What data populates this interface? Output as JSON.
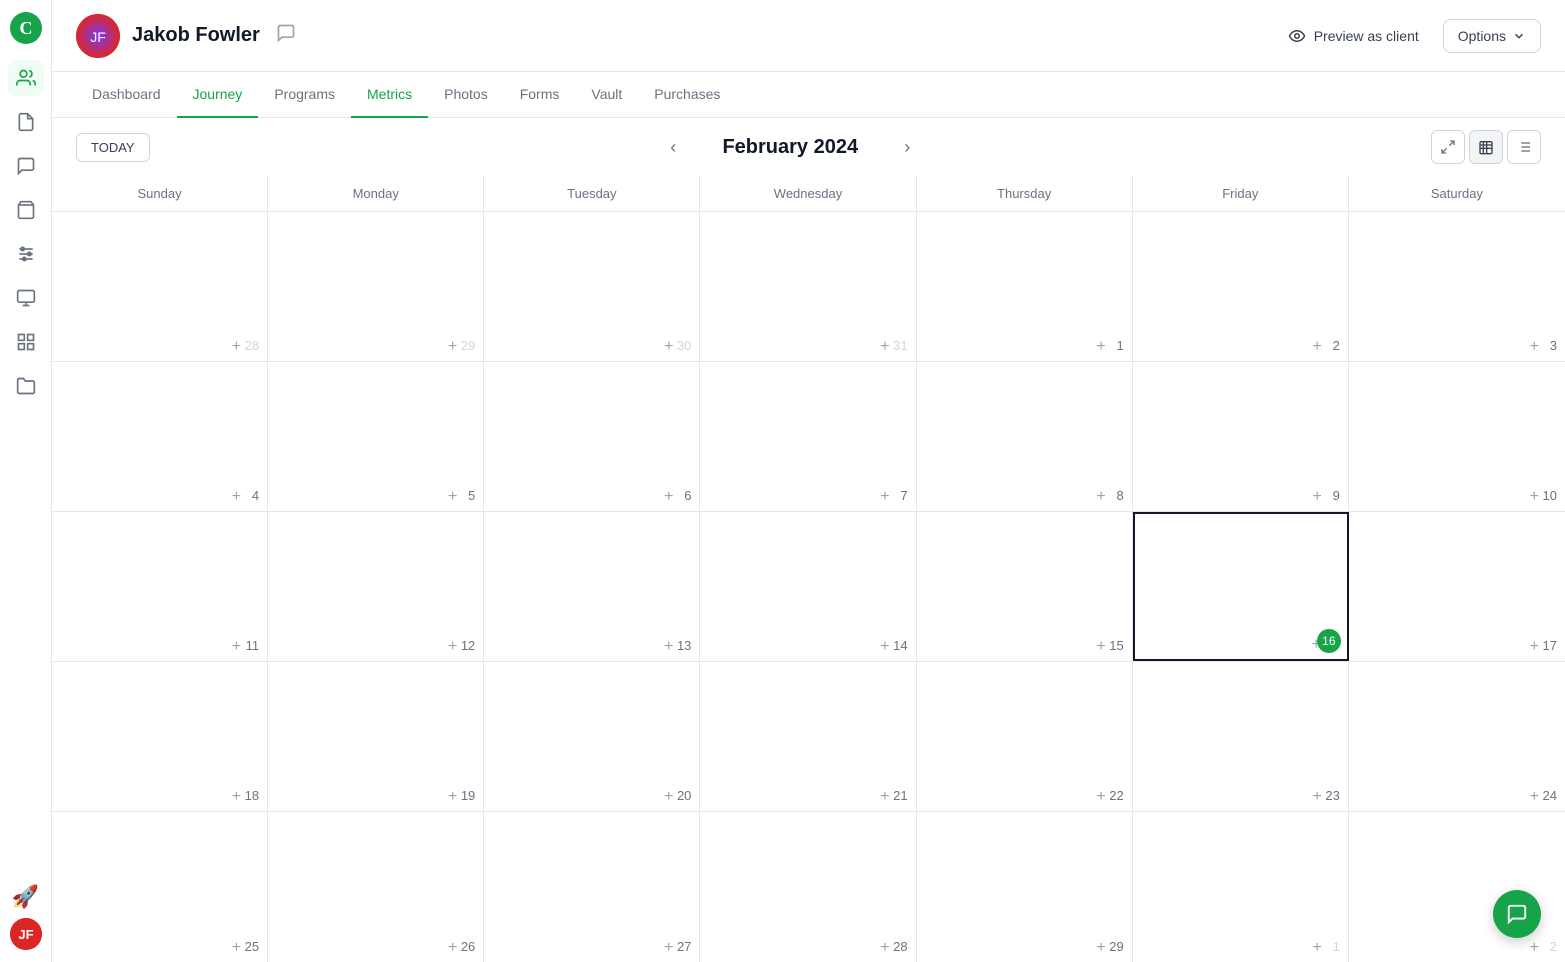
{
  "app": {
    "logo_text": "C"
  },
  "header": {
    "user_name": "Jakob Fowler",
    "preview_label": "Preview as client",
    "options_label": "Options"
  },
  "nav": {
    "tabs": [
      {
        "label": "Dashboard",
        "active": false
      },
      {
        "label": "Journey",
        "active": true,
        "color": "green"
      },
      {
        "label": "Programs",
        "active": false
      },
      {
        "label": "Metrics",
        "active": true,
        "color": "green"
      },
      {
        "label": "Photos",
        "active": false
      },
      {
        "label": "Forms",
        "active": false
      },
      {
        "label": "Vault",
        "active": false
      },
      {
        "label": "Purchases",
        "active": false
      }
    ]
  },
  "calendar": {
    "today_label": "TODAY",
    "month_label": "February 2024",
    "day_headers": [
      "Sunday",
      "Monday",
      "Tuesday",
      "Wednesday",
      "Thursday",
      "Friday",
      "Saturday"
    ],
    "weeks": [
      [
        {
          "day": 28,
          "other": true
        },
        {
          "day": 29,
          "other": true
        },
        {
          "day": 30,
          "other": true
        },
        {
          "day": 31,
          "other": true
        },
        {
          "day": 1
        },
        {
          "day": 2
        },
        {
          "day": 3
        }
      ],
      [
        {
          "day": 4
        },
        {
          "day": 5
        },
        {
          "day": 6
        },
        {
          "day": 7
        },
        {
          "day": 8
        },
        {
          "day": 9
        },
        {
          "day": 10
        }
      ],
      [
        {
          "day": 11
        },
        {
          "day": 12
        },
        {
          "day": 13
        },
        {
          "day": 14
        },
        {
          "day": 15
        },
        {
          "day": 16,
          "today": true
        },
        {
          "day": 17
        }
      ],
      [
        {
          "day": 18
        },
        {
          "day": 19
        },
        {
          "day": 20
        },
        {
          "day": 21
        },
        {
          "day": 22
        },
        {
          "day": 23
        },
        {
          "day": 24
        }
      ],
      [
        {
          "day": 25
        },
        {
          "day": 26
        },
        {
          "day": 27
        },
        {
          "day": 28
        },
        {
          "day": 29
        },
        {
          "day": 1,
          "other": true
        },
        {
          "day": 2,
          "other": true
        }
      ]
    ]
  },
  "sidebar": {
    "icons": [
      {
        "name": "clients-icon",
        "symbol": "👥"
      },
      {
        "name": "document-icon",
        "symbol": "📄"
      },
      {
        "name": "chat-icon",
        "symbol": "💬"
      },
      {
        "name": "bag-icon",
        "symbol": "💼"
      },
      {
        "name": "sliders-icon",
        "symbol": "🎚"
      },
      {
        "name": "monitor-icon",
        "symbol": "🖥"
      },
      {
        "name": "grid-icon",
        "symbol": "⊞"
      },
      {
        "name": "folder-icon",
        "symbol": "📁"
      }
    ]
  }
}
